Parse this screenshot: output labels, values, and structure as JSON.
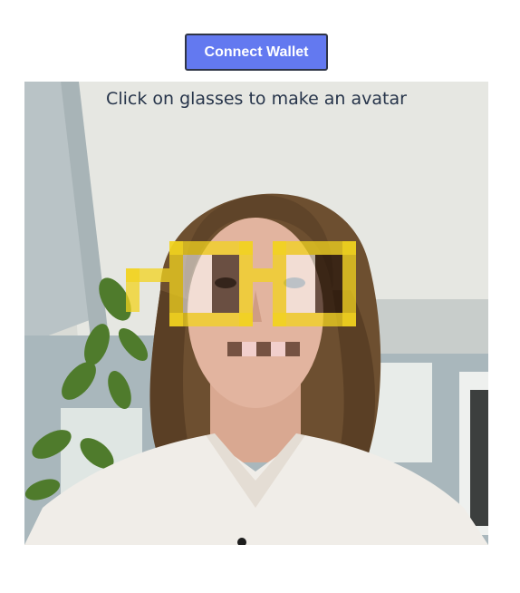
{
  "header": {
    "connect_label": "Connect Wallet",
    "connect_color": "#6379f0"
  },
  "camera": {
    "prompt": "Click on glasses to make an avatar"
  },
  "overlay": {
    "glasses_color": "#f2d31f",
    "glasses_icon": "noggles-glasses-icon",
    "mouth_icon": "pixel-mouth-icon"
  }
}
